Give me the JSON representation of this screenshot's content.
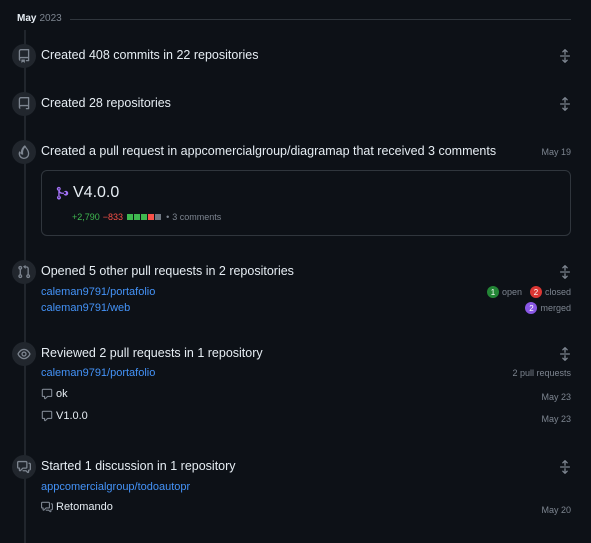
{
  "month": {
    "label": "May",
    "year": "2023"
  },
  "events": {
    "commits": {
      "title": "Created 408 commits in 22 repositories"
    },
    "repos": {
      "title": "Created 28 repositories"
    },
    "pr_created": {
      "title": "Created a pull request in appcomercialgroup/diagramap that received 3 comments",
      "date": "May 19",
      "pr": {
        "title": "V4.0.0",
        "additions": "+2,790",
        "deletions": "−833",
        "separator": "•",
        "comments": "3 comments"
      }
    },
    "opened_prs": {
      "title": "Opened 5 other pull requests in 2 repositories",
      "repos": [
        {
          "name": "caleman9791/portafolio",
          "count": "1",
          "state": "open",
          "count2": "2",
          "state2": "closed"
        },
        {
          "name": "caleman9791/web",
          "count": "2",
          "state": "merged"
        }
      ]
    },
    "reviewed": {
      "title": "Reviewed 2 pull requests in 1 repository",
      "repo": "caleman9791/portafolio",
      "repo_count": "2 pull requests",
      "items": [
        {
          "label": "ok",
          "date": "May 23"
        },
        {
          "label": "V1.0.0",
          "date": "May 23"
        }
      ]
    },
    "discussion": {
      "title": "Started 1 discussion in 1 repository",
      "repo": "appcomercialgroup/todoautopr",
      "item": {
        "label": "Retomando",
        "date": "May 20"
      }
    }
  },
  "colors": {
    "background": "#0d1117",
    "link": "#4493f8",
    "additions": "#3fb950",
    "deletions": "#f85149",
    "merged": "#a371f7",
    "muted": "#7d8590"
  }
}
